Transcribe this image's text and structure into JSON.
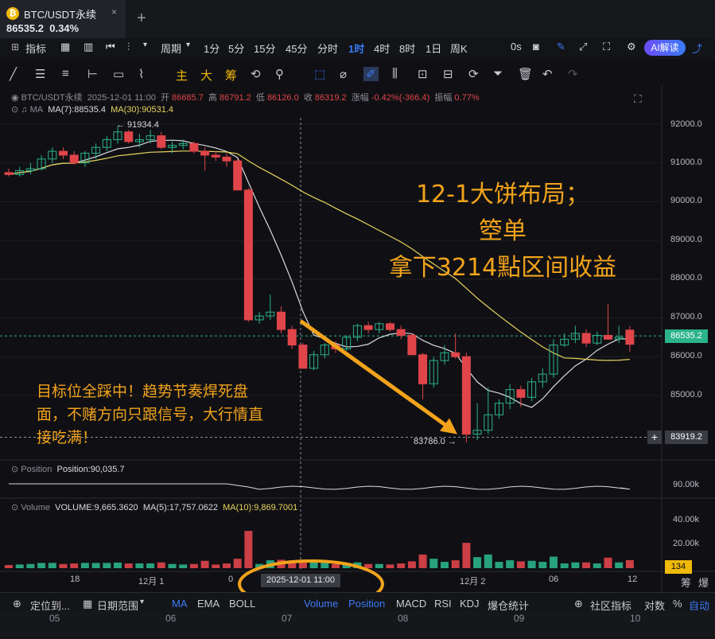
{
  "tab": {
    "name": "BTC/USDT永续",
    "price": "86535.2",
    "change": "0.34%",
    "close": "×",
    "newtab": "+"
  },
  "toolbar1": {
    "indicators": "指标",
    "period": "周期",
    "intervals": [
      "1分",
      "5分",
      "15分",
      "45分",
      "分时",
      "1时",
      "4时",
      "8时",
      "1日",
      "周K"
    ],
    "active_interval": "1时",
    "right_label": "0s",
    "ai": "AI解读"
  },
  "toolbar2": {
    "main": "主",
    "large": "大",
    "chip": "筹"
  },
  "legend": {
    "symbol": "BTC/USDT永续",
    "datetime": "2025-12-01 11:00",
    "open_label": "开",
    "open": "86685.7",
    "high_label": "高",
    "high": "86791.2",
    "low_label": "低",
    "low": "86126.0",
    "close_label": "收",
    "close": "86319.2",
    "chg_label": "涨幅",
    "chg": "-0.42%(-366.4)",
    "amp_label": "振幅",
    "amp": "0.77%",
    "ma_label": "MA",
    "ma7": "MA(7):88535.4",
    "ma30": "MA(30):90531.4"
  },
  "price_axis": [
    "92000.0",
    "91000.0",
    "90000.0",
    "89000.0",
    "88000.0",
    "87000.0",
    "86000.0",
    "85000.0"
  ],
  "current_price": "86535.2",
  "crosshair_price": "83919.2",
  "high_marker": "← 91934.4",
  "low_marker": "83786.0 →",
  "annotation_main": [
    "12-1大饼布局；",
    "箜单",
    "拿下3214點区间收益"
  ],
  "annotation_side": [
    "目标位全踩中！趋势节奏焊死盘",
    "面，不赌方向只跟信号，大行情直",
    "接吃满！"
  ],
  "position": {
    "label": "Position",
    "value": "Position:90,035.7",
    "axis": "90.00k"
  },
  "volume": {
    "label": "Volume",
    "value": "VOLUME:9,665.3620",
    "ma5": "MA(5):17,757.0622",
    "ma10": "MA(10):9,869.7001",
    "axis": [
      "40.00k",
      "20.00k"
    ],
    "last": "134",
    "right_labels": [
      "筹",
      "爆"
    ]
  },
  "time_axis": [
    "18",
    "12月 1",
    "0",
    "12月 2",
    "06",
    "12"
  ],
  "crosshair_date": "2025-12-01 11:00",
  "bottom1": {
    "locate": "定位到...",
    "range": "日期范围",
    "tabs": [
      "MA",
      "EMA",
      "BOLL",
      "Volume",
      "Position",
      "MACD",
      "RSI",
      "KDJ",
      "爆仓统计"
    ],
    "community": "社区指标",
    "log": "对数",
    "pct": "%",
    "auto": "自动"
  },
  "bottom2": [
    "05",
    "06",
    "07",
    "08",
    "09",
    "10"
  ],
  "colors": {
    "up": "#2bb38a",
    "down": "#e0454a",
    "ma7": "#d9dbe0",
    "ma30": "#e6d35c",
    "accent": "#3a7bf6",
    "annotation": "#f2a31b"
  },
  "chart_data": {
    "type": "candlestick",
    "candles": [
      {
        "o": 90750,
        "h": 90850,
        "l": 90650,
        "c": 90700
      },
      {
        "o": 90700,
        "h": 90900,
        "l": 90650,
        "c": 90800
      },
      {
        "o": 90800,
        "h": 91000,
        "l": 90700,
        "c": 90850
      },
      {
        "o": 90850,
        "h": 91200,
        "l": 90800,
        "c": 91100
      },
      {
        "o": 91100,
        "h": 91400,
        "l": 91000,
        "c": 91300
      },
      {
        "o": 91300,
        "h": 91400,
        "l": 91100,
        "c": 91200
      },
      {
        "o": 91200,
        "h": 91300,
        "l": 90950,
        "c": 91000
      },
      {
        "o": 91000,
        "h": 91300,
        "l": 90900,
        "c": 91250
      },
      {
        "o": 91250,
        "h": 91500,
        "l": 91100,
        "c": 91400
      },
      {
        "o": 91400,
        "h": 91700,
        "l": 91300,
        "c": 91600
      },
      {
        "o": 91600,
        "h": 91934,
        "l": 91500,
        "c": 91800
      },
      {
        "o": 91800,
        "h": 91850,
        "l": 91500,
        "c": 91550
      },
      {
        "o": 91550,
        "h": 91750,
        "l": 91400,
        "c": 91600
      },
      {
        "o": 91600,
        "h": 91850,
        "l": 91500,
        "c": 91700
      },
      {
        "o": 91700,
        "h": 91800,
        "l": 91350,
        "c": 91400
      },
      {
        "o": 91400,
        "h": 91550,
        "l": 91250,
        "c": 91450
      },
      {
        "o": 91450,
        "h": 91600,
        "l": 91350,
        "c": 91500
      },
      {
        "o": 91500,
        "h": 91550,
        "l": 91250,
        "c": 91300
      },
      {
        "o": 91300,
        "h": 91400,
        "l": 90800,
        "c": 91200
      },
      {
        "o": 91200,
        "h": 91300,
        "l": 91050,
        "c": 91150
      },
      {
        "o": 91150,
        "h": 91250,
        "l": 90900,
        "c": 91050
      },
      {
        "o": 91050,
        "h": 91100,
        "l": 90300,
        "c": 90300
      },
      {
        "o": 90300,
        "h": 90350,
        "l": 86900,
        "c": 86950
      },
      {
        "o": 86950,
        "h": 87150,
        "l": 86850,
        "c": 87050
      },
      {
        "o": 87050,
        "h": 87600,
        "l": 86950,
        "c": 87150
      },
      {
        "o": 87150,
        "h": 87300,
        "l": 86600,
        "c": 86700
      },
      {
        "o": 86700,
        "h": 86800,
        "l": 86200,
        "c": 86300
      },
      {
        "o": 86300,
        "h": 86350,
        "l": 85700,
        "c": 85700
      },
      {
        "o": 85700,
        "h": 86150,
        "l": 85650,
        "c": 86050
      },
      {
        "o": 86050,
        "h": 86350,
        "l": 85950,
        "c": 86300
      },
      {
        "o": 86300,
        "h": 86400,
        "l": 86100,
        "c": 86200
      },
      {
        "o": 86200,
        "h": 86550,
        "l": 86150,
        "c": 86500
      },
      {
        "o": 86500,
        "h": 86850,
        "l": 86400,
        "c": 86800
      },
      {
        "o": 86800,
        "h": 86900,
        "l": 86600,
        "c": 86700
      },
      {
        "o": 86700,
        "h": 86900,
        "l": 86600,
        "c": 86850
      },
      {
        "o": 86850,
        "h": 86900,
        "l": 86650,
        "c": 86700
      },
      {
        "o": 86700,
        "h": 86800,
        "l": 86450,
        "c": 86550
      },
      {
        "o": 86550,
        "h": 86600,
        "l": 86050,
        "c": 86050
      },
      {
        "o": 86050,
        "h": 86100,
        "l": 84900,
        "c": 85300
      },
      {
        "o": 85300,
        "h": 86000,
        "l": 85200,
        "c": 85900
      },
      {
        "o": 85900,
        "h": 86300,
        "l": 85800,
        "c": 86100
      },
      {
        "o": 86100,
        "h": 86600,
        "l": 85950,
        "c": 86000
      },
      {
        "o": 86000,
        "h": 86100,
        "l": 83786,
        "c": 84000
      },
      {
        "o": 84000,
        "h": 84800,
        "l": 83850,
        "c": 84100
      },
      {
        "o": 84100,
        "h": 85200,
        "l": 84000,
        "c": 84500
      },
      {
        "o": 84500,
        "h": 84900,
        "l": 84400,
        "c": 84800
      },
      {
        "o": 84800,
        "h": 85300,
        "l": 84650,
        "c": 85150
      },
      {
        "o": 85150,
        "h": 85250,
        "l": 84700,
        "c": 84950
      },
      {
        "o": 84950,
        "h": 85450,
        "l": 84850,
        "c": 85350
      },
      {
        "o": 85350,
        "h": 85700,
        "l": 85200,
        "c": 85550
      },
      {
        "o": 85550,
        "h": 86450,
        "l": 85450,
        "c": 86300
      },
      {
        "o": 86300,
        "h": 86600,
        "l": 86250,
        "c": 86450
      },
      {
        "o": 86450,
        "h": 86800,
        "l": 86350,
        "c": 86600
      },
      {
        "o": 86600,
        "h": 86700,
        "l": 86250,
        "c": 86350
      },
      {
        "o": 86350,
        "h": 86650,
        "l": 86300,
        "c": 86550
      },
      {
        "o": 86550,
        "h": 87350,
        "l": 86450,
        "c": 86450
      },
      {
        "o": 86450,
        "h": 86800,
        "l": 86350,
        "c": 86500
      },
      {
        "o": 86685.7,
        "h": 86791.2,
        "l": 86126,
        "c": 86319.2
      }
    ]
  }
}
